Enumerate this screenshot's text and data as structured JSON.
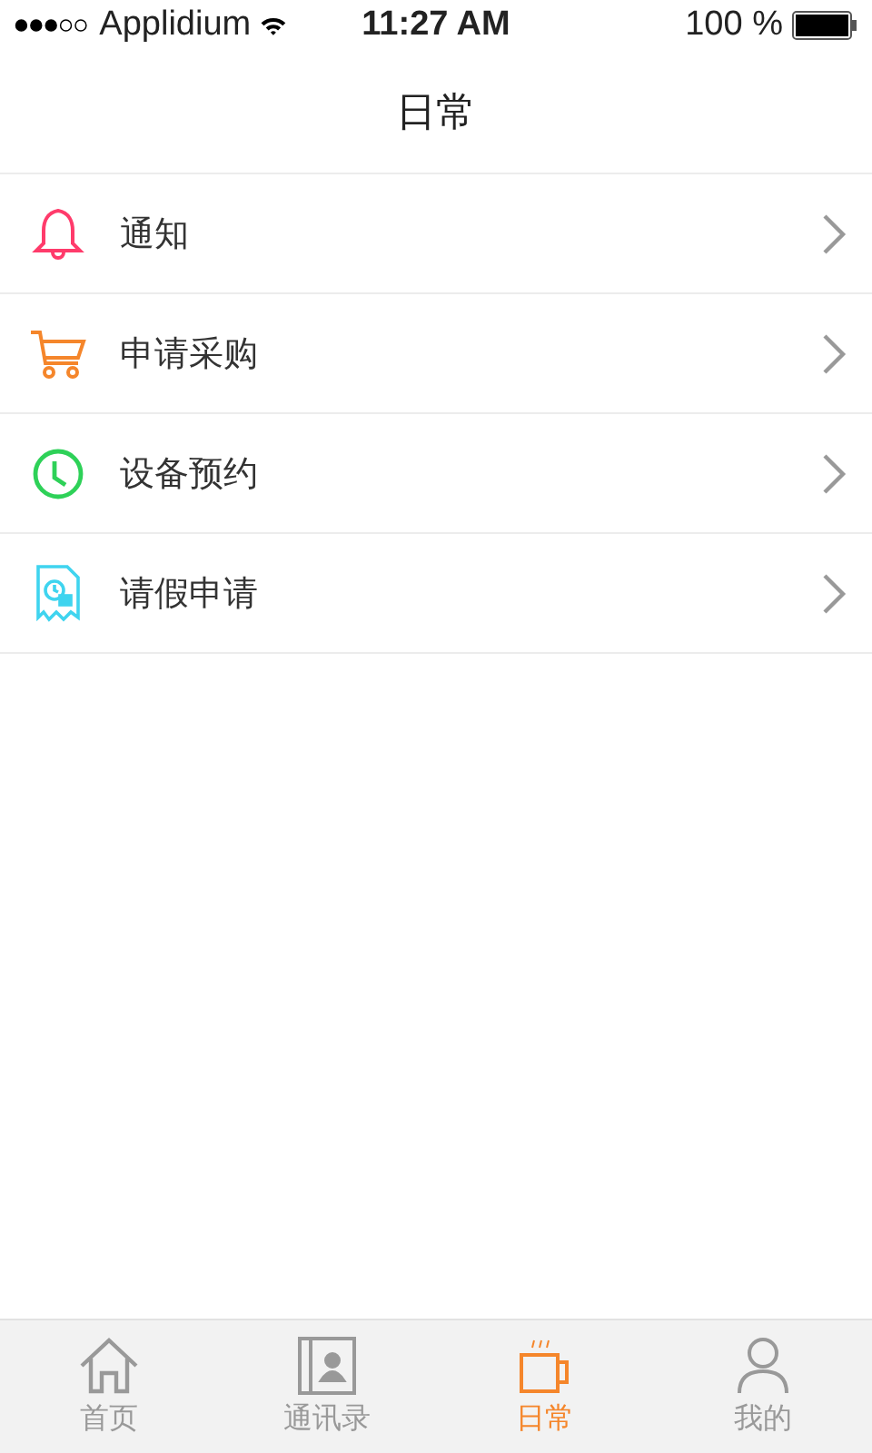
{
  "status_bar": {
    "carrier": "Applidium",
    "time": "11:27 AM",
    "battery": "100 %"
  },
  "nav_bar": {
    "title": "日常"
  },
  "items": [
    {
      "kind": "bell",
      "label": "通知",
      "color": "#ff3b6b"
    },
    {
      "kind": "cart",
      "label": "申请采购",
      "color": "#f5862b"
    },
    {
      "kind": "clock",
      "label": "设备预约",
      "color": "#2ed158"
    },
    {
      "kind": "leave",
      "label": "请假申请",
      "color": "#3fd4ef"
    }
  ],
  "tab_bar": [
    {
      "kind": "home",
      "label": "首页",
      "selected": false
    },
    {
      "kind": "contacts",
      "label": "通讯录",
      "selected": false
    },
    {
      "kind": "cup",
      "label": "日常",
      "selected": true
    },
    {
      "kind": "person",
      "label": "我的",
      "selected": false
    }
  ]
}
